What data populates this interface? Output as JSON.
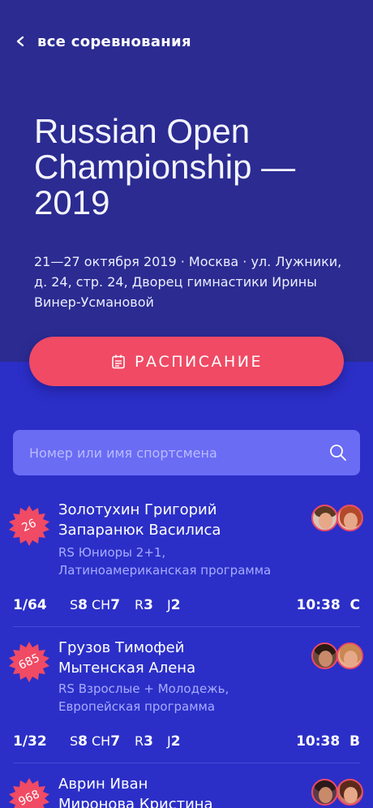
{
  "nav": {
    "back_label": "все соревнования"
  },
  "event": {
    "title": "Russian Open Championship — 2019",
    "details": "21—27 октября 2019 · Москва · ул. Лужники, д.  24, стр. 24, Дворец гимнастики Ирины Винер-Усмановой"
  },
  "schedule_button": {
    "label": "РАСПИСАНИЕ",
    "icon": "calendar-icon"
  },
  "search": {
    "placeholder": "Номер или имя спортсмена",
    "value": "",
    "icon": "search-icon"
  },
  "colors": {
    "header_bg": "#2b2b91",
    "body_bg": "#2b2fc7",
    "accent": "#f04a64",
    "search_bg": "#6a6cf4",
    "category_text": "#a8abff"
  },
  "entries": [
    {
      "number": "26",
      "partner1": "Золотухин Григорий",
      "partner2": "Запаранюк Василиса",
      "category_line1": "RS Юниоры 2+1,",
      "category_line2": "Латиноамериканская программа",
      "round": "1/64",
      "s_label": "S",
      "s_value": "8",
      "ch_label": "CH",
      "ch_value": "7",
      "r_label": "R",
      "r_value": "3",
      "j_label": "J",
      "j_value": "2",
      "time": "10:38",
      "floor": "C"
    },
    {
      "number": "685",
      "partner1": "Грузов Тимофей",
      "partner2": "Мытенская Алена",
      "category_line1": "RS Взрослые + Молодежь,",
      "category_line2": "Европейская программа",
      "round": "1/32",
      "s_label": "S",
      "s_value": "8",
      "ch_label": "CH",
      "ch_value": "7",
      "r_label": "R",
      "r_value": "3",
      "j_label": "J",
      "j_value": "2",
      "time": "10:38",
      "floor": "B"
    },
    {
      "number": "968",
      "partner1": "Аврин Иван",
      "partner2": "Миронова Кристина"
    }
  ]
}
